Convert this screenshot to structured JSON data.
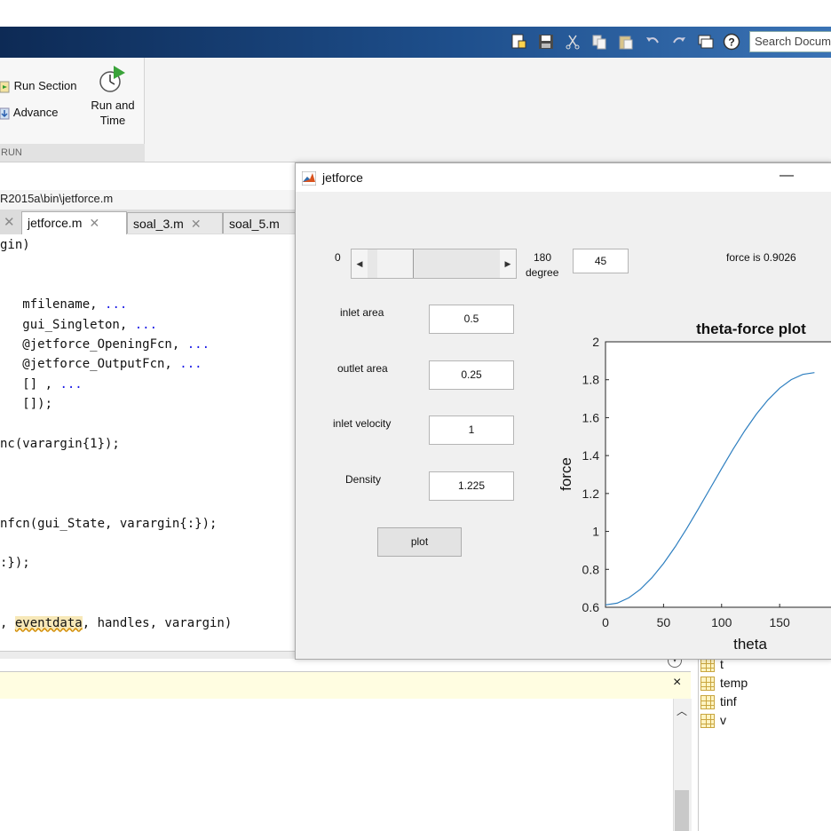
{
  "toolbar": {
    "search_placeholder": "Search Documentation",
    "quick_access_icons": [
      "new-icon",
      "save-icon",
      "cut-icon",
      "copy-icon",
      "paste-icon",
      "undo-icon",
      "redo-icon",
      "switch-windows-icon",
      "help-icon"
    ]
  },
  "ribbon": {
    "run_section_label": "Run Section",
    "advance_label": "Advance",
    "run_and_time_line1": "Run and",
    "run_and_time_line2": "Time",
    "run_group_label": "RUN"
  },
  "editor": {
    "path": "R2015a\\bin\\jetforce.m",
    "tabs": [
      {
        "label": "jetforce.m",
        "active": true
      },
      {
        "label": "soal_3.m",
        "active": false
      },
      {
        "label": "soal_5.m",
        "active": false
      }
    ],
    "lines": [
      "gin)",
      "",
      "",
      "   mfilename, ...",
      "   gui_Singleton, ...",
      "   @jetforce_OpeningFcn, ...",
      "   @jetforce_OutputFcn, ...",
      "   [] , ...",
      "   []);",
      "",
      "nc(varargin{1});",
      "",
      "",
      "",
      "nfcn(gui_State, varargin{:});",
      "",
      ":});",
      "",
      "",
      ", eventdata, handles, varargin)"
    ]
  },
  "command_window": {
    "close_label": "×"
  },
  "workspace": {
    "variables": [
      "t",
      "temp",
      "tinf",
      "v"
    ]
  },
  "figure": {
    "title": "jetforce",
    "slider": {
      "min_label": "0",
      "max_label": "180",
      "unit_label": "degree",
      "value": 45,
      "min": 0,
      "max": 180
    },
    "angle_value": "45",
    "force_text": "force is 0.9026",
    "inputs": [
      {
        "label": "inlet area",
        "value": "0.5"
      },
      {
        "label": "outlet area",
        "value": "0.25"
      },
      {
        "label": "inlet velocity",
        "value": "1"
      },
      {
        "label": "Density",
        "value": "1.225"
      }
    ],
    "plot_button": "plot"
  },
  "chart_data": {
    "type": "line",
    "title": "theta-force plot",
    "xlabel": "theta",
    "ylabel": "force",
    "xlim": [
      0,
      180
    ],
    "ylim": [
      0.6,
      2.0
    ],
    "x_ticks": [
      "0",
      "50",
      "100",
      "150"
    ],
    "y_ticks": [
      "0.6",
      "0.8",
      "1",
      "1.2",
      "1.4",
      "1.6",
      "1.8",
      "2"
    ],
    "series": [
      {
        "color": "#2e7fc0",
        "x": [
          0,
          10,
          20,
          30,
          40,
          50,
          60,
          70,
          80,
          90,
          100,
          110,
          120,
          130,
          140,
          150,
          160,
          170,
          180
        ],
        "y": [
          0.6125,
          0.6217,
          0.6494,
          0.6946,
          0.7558,
          0.8313,
          0.9188,
          1.0155,
          1.1188,
          1.225,
          1.3312,
          1.4345,
          1.5312,
          1.6188,
          1.6942,
          1.7554,
          1.8006,
          1.8283,
          1.8375
        ]
      }
    ]
  }
}
